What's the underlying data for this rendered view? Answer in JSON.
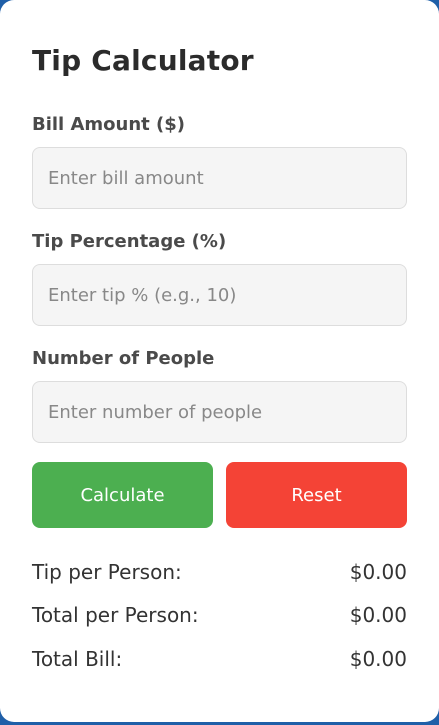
{
  "title": "Tip Calculator",
  "fields": {
    "bill": {
      "label": "Bill Amount ($)",
      "placeholder": "Enter bill amount",
      "value": ""
    },
    "tip": {
      "label": "Tip Percentage (%)",
      "placeholder": "Enter tip % (e.g., 10)",
      "value": ""
    },
    "people": {
      "label": "Number of People",
      "placeholder": "Enter number of people",
      "value": ""
    }
  },
  "buttons": {
    "calculate": "Calculate",
    "reset": "Reset"
  },
  "results": {
    "tip_per_person": {
      "label": "Tip per Person:",
      "value": "$0.00"
    },
    "total_per_person": {
      "label": "Total per Person:",
      "value": "$0.00"
    },
    "total_bill": {
      "label": "Total Bill:",
      "value": "$0.00"
    }
  },
  "colors": {
    "calculate": "#4caf50",
    "reset": "#f44336",
    "frame": "#1f5fa8"
  }
}
